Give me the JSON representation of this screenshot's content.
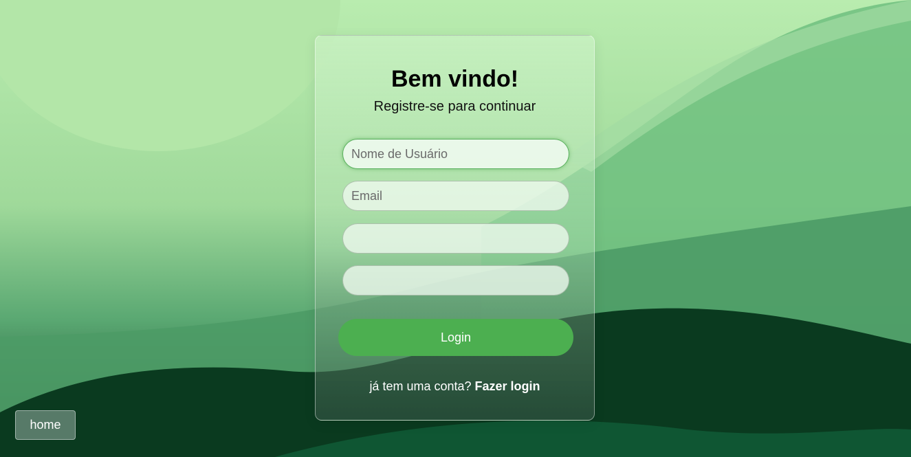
{
  "form": {
    "title": "Bem vindo!",
    "subtitle": "Registre-se para continuar",
    "username_placeholder": "Nome de Usuário",
    "email_placeholder": "Email",
    "password_placeholder": "",
    "confirm_password_placeholder": "",
    "submit_label": "Login",
    "footer_prefix": "já tem uma conta?",
    "footer_link": "Fazer login"
  },
  "nav": {
    "home_label": "home"
  },
  "colors": {
    "accent": "#4caf50",
    "background_light": "#b9ecaf",
    "background_dark": "#0e3d22"
  }
}
